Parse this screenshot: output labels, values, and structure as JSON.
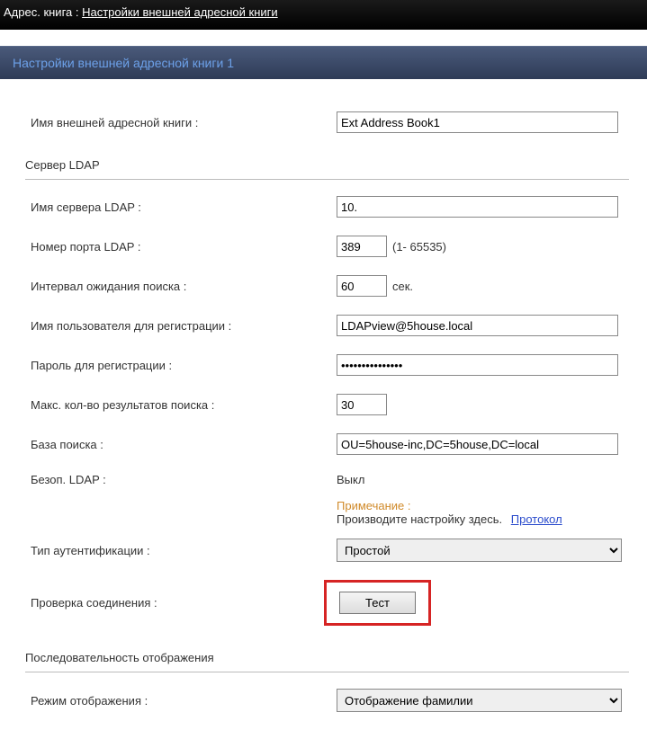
{
  "header": {
    "breadcrumb_prefix": "Адрес. книга : ",
    "breadcrumb_link": "Настройки внешней адресной книги"
  },
  "section_title": "Настройки внешней адресной книги 1",
  "fields": {
    "book_name": {
      "label": "Имя внешней адресной книги :",
      "value": "Ext Address Book1"
    },
    "ldap_section": "Сервер LDAP",
    "server_name": {
      "label": "Имя сервера LDAP :",
      "value": "10."
    },
    "port": {
      "label": "Номер порта LDAP :",
      "value": "389",
      "range": "(1- 65535)"
    },
    "timeout": {
      "label": "Интервал ожидания поиска :",
      "value": "60",
      "unit": "сек."
    },
    "login_user": {
      "label": "Имя пользователя для регистрации :",
      "value": "LDAPview@5house.local"
    },
    "login_pass": {
      "label": "Пароль для регистрации :",
      "value": "●●●●●●●●●●●●●●●"
    },
    "max_results": {
      "label": "Макс. кол-во результатов поиска :",
      "value": "30"
    },
    "search_base": {
      "label": "База поиска :",
      "value": "OU=5house-inc,DC=5house,DC=local"
    },
    "secure_ldap": {
      "label": "Безоп. LDAP :",
      "value": "Выкл"
    },
    "note": {
      "label": "Примечание :",
      "text": "Производите настройку здесь.",
      "link": "Протокол"
    },
    "auth_type": {
      "label": "Тип аутентификации :",
      "selected": "Простой"
    },
    "conn_test": {
      "label": "Проверка соединения :",
      "button": "Тест"
    },
    "display_section": "Последовательность отображения",
    "display_mode": {
      "label": "Режим отображения :",
      "selected": "Отображение фамилии"
    }
  }
}
